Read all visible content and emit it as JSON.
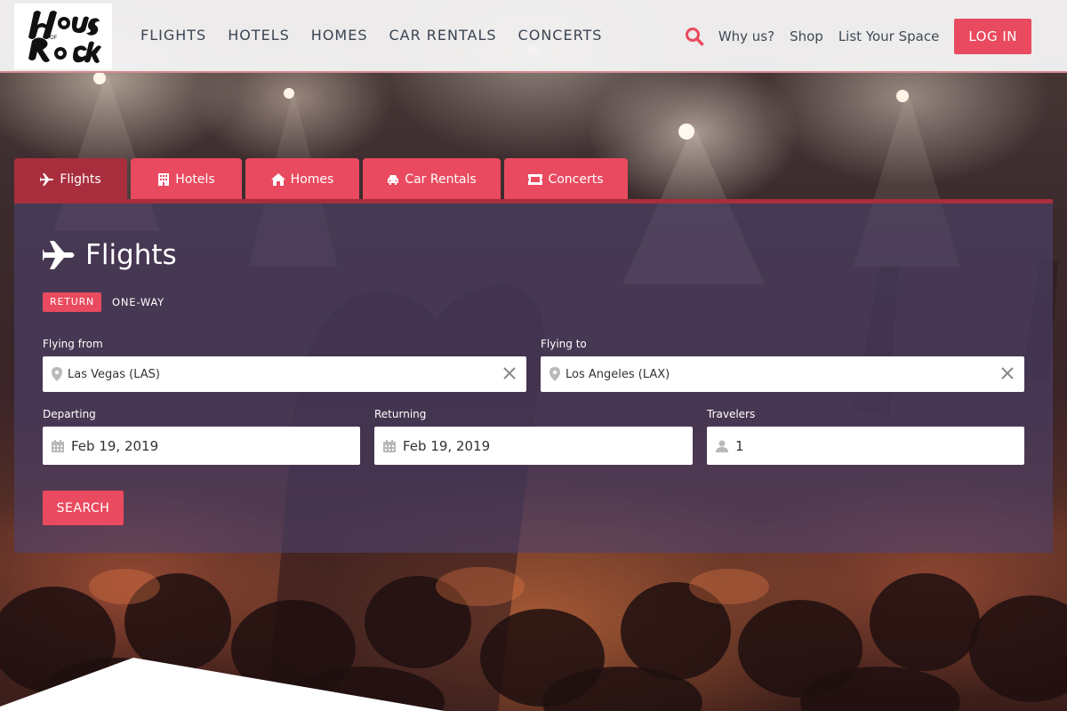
{
  "brand": {
    "logo_text": "House of Rock"
  },
  "nav": {
    "items": [
      "FLIGHTS",
      "HOTELS",
      "HOMES",
      "CAR RENTALS",
      "CONCERTS"
    ],
    "links": [
      "Why us?",
      "Shop",
      "List Your Space"
    ],
    "login_label": "LOG IN",
    "search_icon": "search-icon"
  },
  "tabs": [
    {
      "label": "Flights",
      "icon": "plane-icon",
      "active": true
    },
    {
      "label": "Hotels",
      "icon": "building-icon",
      "active": false
    },
    {
      "label": "Homes",
      "icon": "home-icon",
      "active": false
    },
    {
      "label": "Car Rentals",
      "icon": "car-icon",
      "active": false
    },
    {
      "label": "Concerts",
      "icon": "ticket-icon",
      "active": false
    }
  ],
  "panel": {
    "title": "Flights",
    "trip_types": {
      "active": "RETURN",
      "other": "ONE-WAY"
    },
    "from": {
      "label": "Flying from",
      "value": "Las Vegas (LAS)"
    },
    "to": {
      "label": "Flying to",
      "value": "Los Angeles (LAX)"
    },
    "depart": {
      "label": "Departing",
      "value": "Feb 19, 2019"
    },
    "return": {
      "label": "Returning",
      "value": "Feb 19, 2019"
    },
    "travelers": {
      "label": "Travelers",
      "value": "1"
    },
    "search_label": "SEARCH"
  },
  "colors": {
    "accent": "#e94a5f",
    "accent_dark": "#a92e3d",
    "panel": "#4e426c",
    "nav_text": "#3a4452"
  }
}
